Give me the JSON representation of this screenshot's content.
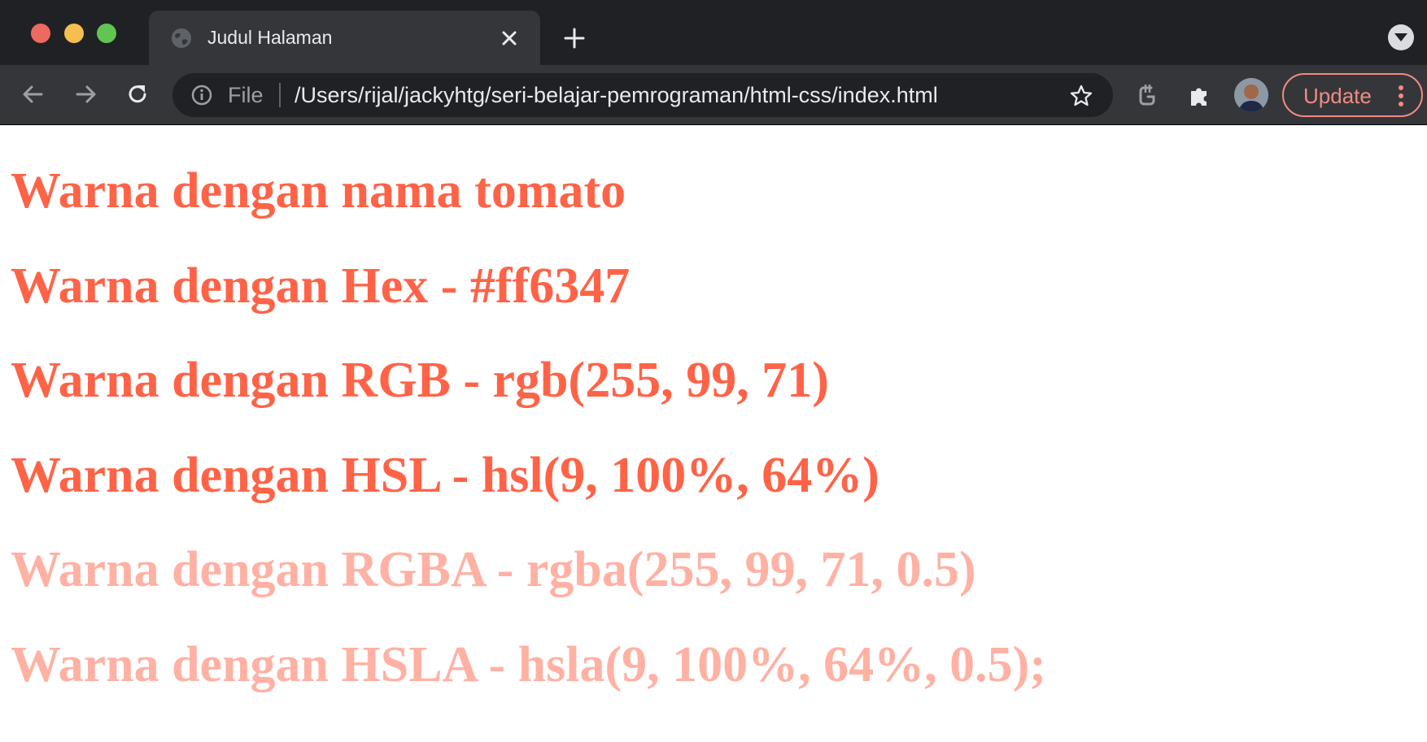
{
  "browser": {
    "tab": {
      "title": "Judul Halaman"
    },
    "omnibox": {
      "scheme_label": "File",
      "url": "/Users/rijal/jackyhtg/seri-belajar-pemrograman/html-css/index.html"
    },
    "update_button": {
      "label": "Update"
    },
    "icons": [
      "back-arrow-icon",
      "forward-arrow-icon",
      "reload-icon",
      "info-icon",
      "star-icon",
      "grammarly-icon",
      "puzzle-icon",
      "kebab-menu-icon"
    ]
  },
  "page": {
    "headings": [
      {
        "text": "Warna dengan nama tomato",
        "color": "tomato"
      },
      {
        "text": "Warna dengan Hex - #ff6347",
        "color": "#ff6347"
      },
      {
        "text": "Warna dengan RGB - rgb(255, 99, 71)",
        "color": "rgb(255, 99, 71)"
      },
      {
        "text": "Warna dengan HSL - hsl(9, 100%, 64%)",
        "color": "hsl(9, 100%, 64%)"
      },
      {
        "text": "Warna dengan RGBA - rgba(255, 99, 71, 0.5)",
        "color": "rgba(255, 99, 71, 0.5)"
      },
      {
        "text": "Warna dengan HSLA - hsla(9, 100%, 64%, 0.5);",
        "color": "hsla(9, 100%, 64%, 0.5)"
      }
    ]
  },
  "colors": {
    "tab_strip": "#202124",
    "toolbar": "#35363a",
    "update_accent": "#f28b82"
  }
}
